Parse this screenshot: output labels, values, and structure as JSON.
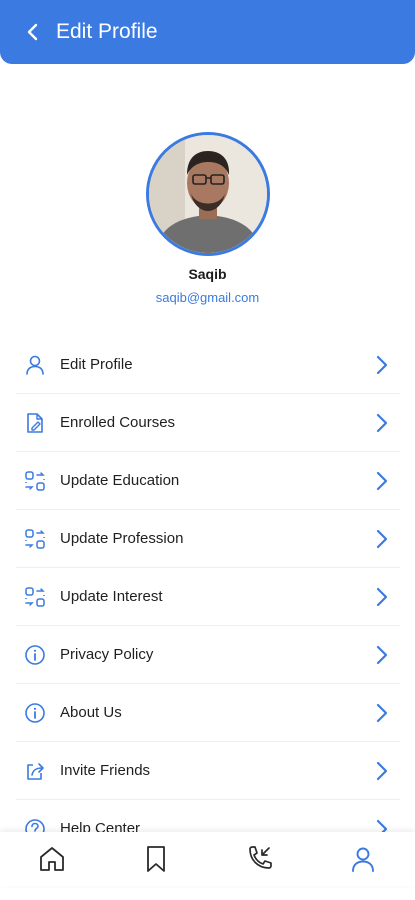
{
  "header": {
    "title": "Edit Profile",
    "back_icon": "chevron-left-icon"
  },
  "profile": {
    "name": "Saqib",
    "email": "saqib@gmail.com"
  },
  "colors": {
    "accent": "#3b7ae0",
    "text": "#1f1f1f"
  },
  "menu": [
    {
      "label": "Edit Profile",
      "icon": "user-icon"
    },
    {
      "label": "Enrolled Courses",
      "icon": "courses-icon"
    },
    {
      "label": "Update Education",
      "icon": "exchange-icon"
    },
    {
      "label": "Update Profession",
      "icon": "exchange-icon"
    },
    {
      "label": "Update Interest",
      "icon": "exchange-icon"
    },
    {
      "label": "Privacy Policy",
      "icon": "info-icon"
    },
    {
      "label": "About Us",
      "icon": "info-icon"
    },
    {
      "label": "Invite Friends",
      "icon": "share-icon"
    },
    {
      "label": "Help Center",
      "icon": "help-icon"
    }
  ],
  "bottom_nav": [
    {
      "icon": "home-icon",
      "active": false
    },
    {
      "icon": "bookmark-icon",
      "active": false
    },
    {
      "icon": "call-icon",
      "active": false
    },
    {
      "icon": "profile-icon",
      "active": true
    }
  ]
}
